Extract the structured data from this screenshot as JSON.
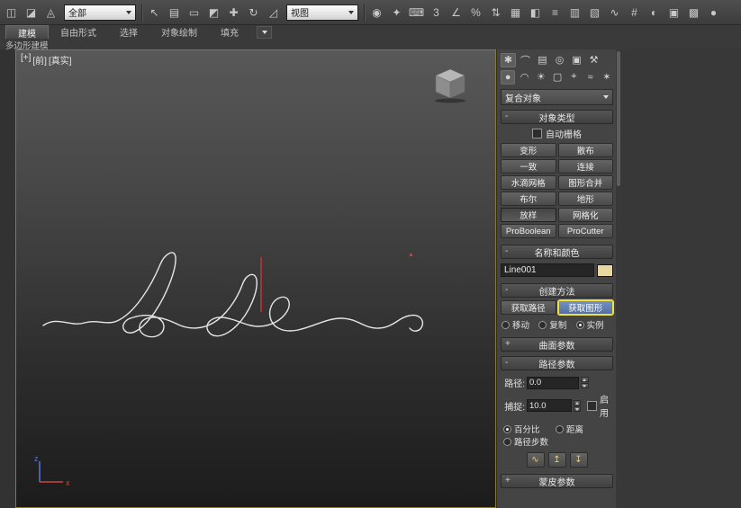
{
  "toolbar": {
    "icons_left": [
      {
        "name": "select-and-link-icon",
        "glyph": "◫"
      },
      {
        "name": "unlink-selection-icon",
        "glyph": "◪"
      },
      {
        "name": "bind-to-space-warp-icon",
        "glyph": "◬"
      }
    ],
    "filter_dropdown_value": "全部",
    "icons_mid": [
      {
        "name": "select-object-icon",
        "glyph": "↖"
      },
      {
        "name": "select-by-name-icon",
        "glyph": "▤"
      },
      {
        "name": "rectangular-selection-region-icon",
        "glyph": "▭"
      },
      {
        "name": "window-crossing-icon",
        "glyph": "◩"
      },
      {
        "name": "select-and-move-icon",
        "glyph": "✚"
      },
      {
        "name": "select-and-rotate-icon",
        "glyph": "↻"
      },
      {
        "name": "select-and-scale-icon",
        "glyph": "◿"
      }
    ],
    "coord_dropdown_value": "视图",
    "icons_right": [
      {
        "name": "use-pivot-point-center-icon",
        "glyph": "◉"
      },
      {
        "name": "select-and-manipulate-icon",
        "glyph": "✦"
      },
      {
        "name": "keyboard-shortcut-override-icon",
        "glyph": "⌨"
      },
      {
        "name": "snaps-toggle-icon",
        "glyph": "3"
      },
      {
        "name": "angle-snap-toggle-icon",
        "glyph": "∠"
      },
      {
        "name": "percent-snap-toggle-icon",
        "glyph": "%"
      },
      {
        "name": "spinner-snap-toggle-icon",
        "glyph": "⇅"
      },
      {
        "name": "named-selection-sets-icon",
        "glyph": "▦"
      },
      {
        "name": "mirror-icon",
        "glyph": "◧"
      },
      {
        "name": "align-icon",
        "glyph": "≡"
      },
      {
        "name": "layer-manager-icon",
        "glyph": "▥"
      },
      {
        "name": "ribbon-toggle-icon",
        "glyph": "▧"
      },
      {
        "name": "curve-editor-icon",
        "glyph": "∿"
      },
      {
        "name": "schematic-view-icon",
        "glyph": "#"
      },
      {
        "name": "material-editor-icon",
        "glyph": "◐"
      },
      {
        "name": "render-setup-icon",
        "glyph": "▣"
      },
      {
        "name": "rendered-frame-window-icon",
        "glyph": "▩"
      },
      {
        "name": "render-production-icon",
        "glyph": "●"
      }
    ]
  },
  "ribbon": {
    "tabs": [
      {
        "label": "建模",
        "active": true
      },
      {
        "label": "自由形式",
        "active": false
      },
      {
        "label": "选择",
        "active": false
      },
      {
        "label": "对象绘制",
        "active": false
      },
      {
        "label": "填充",
        "active": false
      }
    ],
    "panel_label": "多边形建模"
  },
  "viewport": {
    "labels": [
      {
        "text": "[+]"
      },
      {
        "text": "[前]"
      },
      {
        "text": "[真实]"
      }
    ],
    "axis_x_label": "x",
    "axis_z_label": "z"
  },
  "panel": {
    "tabs": [
      {
        "name": "tab-create",
        "glyph": "✱",
        "active": true
      },
      {
        "name": "tab-modify",
        "glyph": "⌒",
        "active": false
      },
      {
        "name": "tab-hierarchy",
        "glyph": "▤",
        "active": false
      },
      {
        "name": "tab-motion",
        "glyph": "◎",
        "active": false
      },
      {
        "name": "tab-display",
        "glyph": "▣",
        "active": false
      },
      {
        "name": "tab-utilities",
        "glyph": "⚒",
        "active": false
      }
    ],
    "subtabs": [
      {
        "name": "subtab-geometry",
        "glyph": "●",
        "active": true
      },
      {
        "name": "subtab-shapes",
        "glyph": "◠",
        "active": false
      },
      {
        "name": "subtab-lights",
        "glyph": "☀",
        "active": false
      },
      {
        "name": "subtab-cameras",
        "glyph": "▢",
        "active": false
      },
      {
        "name": "subtab-helpers",
        "glyph": "⌖",
        "active": false
      },
      {
        "name": "subtab-space-warps",
        "glyph": "≈",
        "active": false
      },
      {
        "name": "subtab-systems",
        "glyph": "✶",
        "active": false
      }
    ],
    "category_dropdown": "复合对象",
    "object_type": {
      "state": "-",
      "title": "对象类型",
      "autogrid_label": "自动栅格",
      "buttons": [
        {
          "label": "变形",
          "pressed": false
        },
        {
          "label": "散布",
          "pressed": false
        },
        {
          "label": "一致",
          "pressed": false
        },
        {
          "label": "连接",
          "pressed": false
        },
        {
          "label": "水滴网格",
          "pressed": false
        },
        {
          "label": "图形合并",
          "pressed": false
        },
        {
          "label": "布尔",
          "pressed": false
        },
        {
          "label": "地形",
          "pressed": false
        },
        {
          "label": "放样",
          "pressed": true
        },
        {
          "label": "网格化",
          "pressed": false
        },
        {
          "label": "ProBoolean",
          "pressed": false
        },
        {
          "label": "ProCutter",
          "pressed": false
        }
      ]
    },
    "name_color": {
      "state": "-",
      "title": "名称和颜色",
      "name_value": "Line001",
      "swatch_color": "#e8d8a0"
    },
    "creation_method": {
      "state": "-",
      "title": "创建方法",
      "get_path_label": "获取路径",
      "get_shape_label": "获取图形",
      "radios": [
        {
          "label": "移动",
          "selected": false
        },
        {
          "label": "复制",
          "selected": false
        },
        {
          "label": "实例",
          "selected": true
        }
      ]
    },
    "surface_params": {
      "state": "+",
      "title": "曲面参数"
    },
    "path_params": {
      "state": "-",
      "title": "路径参数",
      "path_label": "路径:",
      "path_value": "0.0",
      "snap_label": "捕捉:",
      "snap_value": "10.0",
      "enable_label": "启用",
      "mode_radios": [
        {
          "label": "百分比",
          "selected": true,
          "wide": false
        },
        {
          "label": "距离",
          "selected": false,
          "wide": false
        },
        {
          "label": "路径步数",
          "selected": false,
          "wide": true
        }
      ],
      "buttons": [
        {
          "name": "pick-shape-button",
          "glyph": "∿"
        },
        {
          "name": "previous-shape-button",
          "glyph": "↥"
        },
        {
          "name": "next-shape-button",
          "glyph": "↧"
        }
      ]
    },
    "skin_params": {
      "state": "+",
      "title": "蒙皮参数"
    }
  },
  "colors": {
    "viewport_border": "#8a7a2e",
    "spline": "#e6e6e6",
    "red_axis": "#cc3333",
    "axis_x": "#cc4444",
    "axis_z": "#5577dd",
    "active_shape_button_bg": "#51709e",
    "active_shape_button_border": "#f0e13c",
    "name_swatch": "#e8d8a0"
  }
}
